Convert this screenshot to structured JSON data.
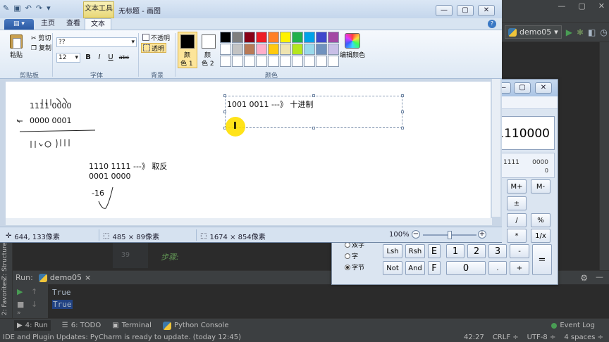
{
  "paint": {
    "context_tab": "文本工具",
    "title": "无标题 - 画图",
    "tabs": [
      "主页",
      "查看",
      "文本"
    ],
    "active_tab": "文本",
    "clipboard": {
      "paste": "粘贴",
      "cut": "剪切",
      "copy": "复制",
      "group": "剪贴板"
    },
    "font": {
      "family": "??",
      "size": "12",
      "bold": "B",
      "italic": "I",
      "underline": "U",
      "strike": "abc",
      "group": "字体"
    },
    "background": {
      "opaque": "不透明",
      "transparent": "透明",
      "group": "背景"
    },
    "colors": {
      "color1_line1": "颜",
      "color1_line2": "色 1",
      "color2_line1": "颜",
      "color2_line2": "色 2",
      "edit": "编辑颜色",
      "group": "颜色",
      "color1_value": "#000000",
      "color2_value": "#ffffff",
      "palette": [
        "#000000",
        "#7f7f7f",
        "#880015",
        "#ed1c24",
        "#ff7f27",
        "#fff200",
        "#22b14c",
        "#00a2e8",
        "#3f48cc",
        "#a349a4",
        "#ffffff",
        "#c3c3c3",
        "#b97a57",
        "#ffaec9",
        "#ffc90e",
        "#efe4b0",
        "#b5e61d",
        "#99d9ea",
        "#7092be",
        "#c8bfe7",
        "#ffffff",
        "#ffffff",
        "#ffffff",
        "#ffffff",
        "#ffffff",
        "#ffffff",
        "#ffffff",
        "#ffffff",
        "#ffffff",
        "#ffffff"
      ]
    },
    "canvas": {
      "textbox_text": "1001  0011  ---》 十进制",
      "line_a": "1111  0000",
      "line_b": "0000  0001",
      "line_c": "1110  1111  ---》   取反",
      "line_d": "0001  0000",
      "line_e": "-16"
    },
    "status": {
      "cursor_pos": "644, 133像素",
      "selection_size": "485 × 89像素",
      "image_size": "1674 × 854像素",
      "zoom": "100%",
      "zoom_level_fraction": 0.5
    }
  },
  "calculator": {
    "display": "1110000",
    "bin_row1_left": "1111",
    "bin_row1_right": "0000",
    "bin_row2_right": "0",
    "radios": [
      "双字",
      "字",
      "字节"
    ],
    "selected_radio": "字节",
    "buttons": {
      "mplus": "M+",
      "mminus": "M-",
      "pm": "±",
      "div": "/",
      "pct": "%",
      "mul": "*",
      "recip": "1/x",
      "minus": "-",
      "plus": "+",
      "equals": "=",
      "lsh": "Lsh",
      "rsh": "Rsh",
      "E": "E",
      "F": "F",
      "one": "1",
      "two": "2",
      "three": "3",
      "zero": "0",
      "dot": ".",
      "not": "Not",
      "and": "And"
    }
  },
  "pycharm": {
    "run_config": "demo05",
    "editor_line_number": "39",
    "editor_comment": "步骤:",
    "run_label": "Run:",
    "run_tab": "demo05",
    "output": [
      "True",
      "True"
    ],
    "side_tabs": {
      "structure": "Z: Structure",
      "favorites": "2: Favorites"
    },
    "bottom_tabs": [
      "4: Run",
      "6: TODO",
      "Terminal",
      "Python Console"
    ],
    "event_log": "Event Log",
    "status_message": "IDE and Plugin Updates: PyCharm is ready to update. (today 12:45)",
    "status_right": [
      "42:27",
      "CRLF ÷",
      "UTF-8 ÷",
      "4 spaces ÷"
    ]
  }
}
